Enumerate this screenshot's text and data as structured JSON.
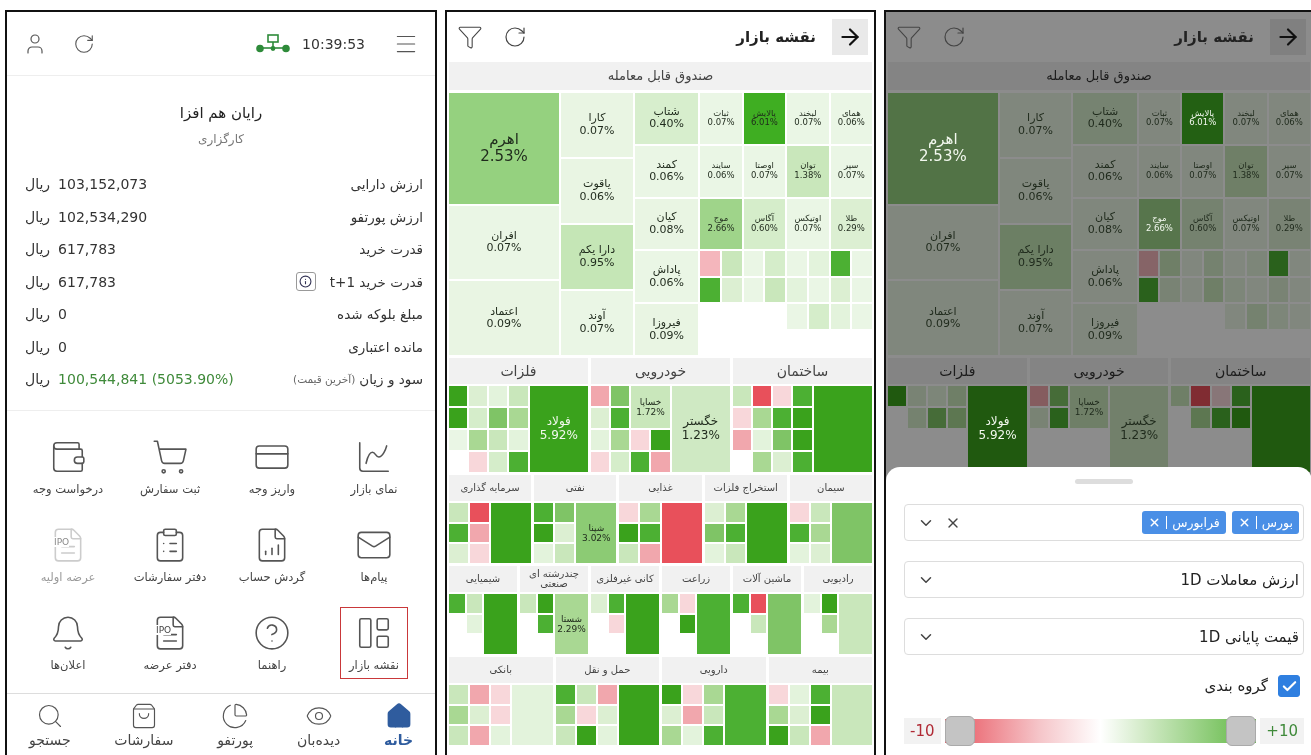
{
  "home": {
    "clock": "10:39:53",
    "broker": {
      "name": "رایان هم افزا",
      "type": "کارگزاری"
    },
    "rows": [
      {
        "label": "ارزش دارایی",
        "value": "103,152,073",
        "unit": "ریال"
      },
      {
        "label": "ارزش پورتفو",
        "value": "102,534,290",
        "unit": "ریال"
      },
      {
        "label": "قدرت خرید",
        "value": "617,783",
        "unit": "ریال"
      },
      {
        "label": "قدرت خرید t+1",
        "info": true,
        "value": "617,783",
        "unit": "ریال"
      },
      {
        "label": "مبلغ بلوکه شده",
        "value": "0",
        "unit": "ریال"
      },
      {
        "label": "مانده اعتباری",
        "value": "0",
        "unit": "ریال"
      },
      {
        "label": "سود و زیان",
        "note": "(آخرین قیمت)",
        "value": "100,544,841 (5053.90%)",
        "unit": "ریال",
        "positive": true
      }
    ],
    "shortcuts": [
      {
        "label": "نمای بازار",
        "disabled": false,
        "highlighted": false
      },
      {
        "label": "واریز وجه",
        "disabled": false,
        "highlighted": false
      },
      {
        "label": "ثبت سفارش",
        "disabled": false,
        "highlighted": false
      },
      {
        "label": "درخواست وجه",
        "disabled": false,
        "highlighted": false
      },
      {
        "label": "پیام‌ها",
        "disabled": false,
        "highlighted": false
      },
      {
        "label": "گردش حساب",
        "disabled": false,
        "highlighted": false
      },
      {
        "label": "دفتر سفارشات",
        "disabled": false,
        "highlighted": false
      },
      {
        "label": "عرضه اولیه",
        "icon_text": "IPO",
        "disabled": true,
        "highlighted": false
      },
      {
        "label": "نقشه بازار",
        "disabled": false,
        "highlighted": true
      },
      {
        "label": "راهنما",
        "disabled": false,
        "highlighted": false
      },
      {
        "label": "دفتر عرضه",
        "icon_text": "IPO",
        "disabled": false,
        "highlighted": false
      },
      {
        "label": "اعلان‌ها",
        "disabled": false,
        "highlighted": false
      }
    ],
    "nav": [
      {
        "label": "خانه",
        "selected": true
      },
      {
        "label": "دیده‌بان",
        "selected": false
      },
      {
        "label": "پورتفو",
        "selected": false
      },
      {
        "label": "سفارشات",
        "selected": false
      },
      {
        "label": "جستجو",
        "selected": false
      }
    ]
  },
  "market_map": {
    "title": "نقشه بازار",
    "fund": {
      "title": "صندوق قابل معامله",
      "cluster": [
        {
          "label": "همای",
          "value": "0.06%",
          "color": "#eaf6e5"
        },
        {
          "label": "لبخند",
          "value": "0.07%",
          "color": "#eaf6e5"
        },
        {
          "label": "پالایش",
          "value": "6.01%",
          "color": "#3fae22"
        },
        {
          "label": "ثبات",
          "value": "0.07%",
          "color": "#eaf6e5"
        },
        {
          "label": "سپر",
          "value": "0.07%",
          "color": "#eaf6e5"
        },
        {
          "label": "توان",
          "value": "1.38%",
          "color": "#c9e7bb"
        },
        {
          "label": "اوصتا",
          "value": "0.07%",
          "color": "#eaf6e5"
        },
        {
          "label": "سایند",
          "value": "0.06%",
          "color": "#eaf6e5"
        },
        {
          "label": "طلا",
          "value": "0.29%",
          "color": "#dcefd2"
        },
        {
          "label": "اوتیکس",
          "value": "0.07%",
          "color": "#eaf6e5"
        },
        {
          "label": "آگاس",
          "value": "0.60%",
          "color": "#d5edca"
        },
        {
          "label": "موج",
          "value": "2.66%",
          "color": "#9fd48a"
        },
        {
          "color": "#eaf6e5"
        },
        {
          "color": "#4cb033"
        },
        {
          "color": "#e3f3dc"
        },
        {
          "color": "#eaf6e5"
        },
        {
          "color": "#d5edca"
        },
        {
          "color": "#eaf6e5"
        },
        {
          "color": "#c9e7bb"
        },
        {
          "color": "#f4b6bc"
        },
        {
          "color": "#eaf6e5"
        },
        {
          "color": "#dcefd2"
        },
        {
          "color": "#eaf6e5"
        },
        {
          "color": "#e3f3dc"
        },
        {
          "color": "#c9e7bb"
        },
        {
          "color": "#eaf6e5"
        },
        {
          "color": "#dcefd2"
        },
        {
          "color": "#4cb033"
        },
        {
          "color": "#eaf6e5"
        },
        {
          "color": "#e3f3dc"
        },
        {
          "color": "#d5edca"
        },
        {
          "color": "#eaf6e5"
        }
      ],
      "columns": [
        [
          {
            "label": "شتاب",
            "value": "0.40%",
            "color": "#d7eecd"
          },
          {
            "label": "کمند",
            "value": "0.06%",
            "color": "#eaf6e5"
          },
          {
            "label": "کیان",
            "value": "0.08%",
            "color": "#e9f5e3"
          },
          {
            "label": "پاداش",
            "value": "0.06%",
            "color": "#eaf6e5"
          },
          {
            "label": "فیروزا",
            "value": "0.09%",
            "color": "#e9f5e3"
          }
        ],
        [
          {
            "label": "کارا",
            "value": "0.07%",
            "color": "#e9f5e3"
          },
          {
            "label": "یاقوت",
            "value": "0.06%",
            "color": "#e9f5e3"
          },
          {
            "label": "دارا یکم",
            "value": "0.95%",
            "color": "#c5e6b6"
          },
          {
            "label": "آوند",
            "value": "0.07%",
            "color": "#eaf6e5"
          }
        ],
        [
          {
            "label": "اهرم",
            "value": "2.53%",
            "color": "#95d17f"
          },
          {
            "label": "افران",
            "value": "0.07%",
            "color": "#eaf6e5"
          },
          {
            "label": "اعتماد",
            "value": "0.09%",
            "color": "#e9f5e3"
          }
        ]
      ]
    },
    "sector_rows": [
      [
        {
          "title": "ساختمان",
          "tiles": [
            {
              "color": "#3aa21c"
            },
            {
              "color": "#4cb033"
            },
            {
              "color": "#f8d7da"
            },
            {
              "color": "#e8505b"
            },
            {
              "color": "#c9e7bb"
            },
            {
              "color": "#3aa21c"
            },
            {
              "color": "#4cb033"
            },
            {
              "color": "#a9d893"
            },
            {
              "color": "#f8d7da"
            },
            {
              "color": "#3aa21c"
            },
            {
              "color": "#7fc466"
            },
            {
              "color": "#e3f3dc"
            },
            {
              "color": "#f1a7ad"
            },
            {
              "color": "#4cb033"
            },
            {
              "color": "#dcefd2"
            },
            {
              "color": "#a9d893"
            }
          ]
        },
        {
          "title": "خودرویی",
          "tiles": [
            {
              "label": "خگستر",
              "value": "1.23%",
              "color": "#cfe9c3"
            },
            {
              "label": "خساپا",
              "value": "1.72%",
              "color": "#c9e7bb"
            },
            {
              "color": "#7fc466"
            },
            {
              "color": "#f1a7ad"
            },
            {
              "color": "#4cb033"
            },
            {
              "color": "#dcefd2"
            },
            {
              "color": "#3aa21c"
            },
            {
              "color": "#f8d7da"
            },
            {
              "color": "#a9d893"
            },
            {
              "color": "#e3f3dc"
            },
            {
              "color": "#f1a7ad"
            },
            {
              "color": "#4cb033"
            },
            {
              "color": "#d5edca"
            },
            {
              "color": "#f8d7da"
            }
          ]
        },
        {
          "title": "فلزات",
          "tiles": [
            {
              "label": "فولاد",
              "value": "5.92%",
              "color": "#3aa21c"
            },
            {
              "color": "#c9e7bb"
            },
            {
              "color": "#e3f3dc"
            },
            {
              "color": "#dcefd2"
            },
            {
              "color": "#3aa21c"
            },
            {
              "color": "#a9d893"
            },
            {
              "color": "#7fc466"
            },
            {
              "color": "#d5edca"
            },
            {
              "color": "#3aa21c"
            },
            {
              "color": "#e3f3dc"
            },
            {
              "color": "#c9e7bb"
            },
            {
              "color": "#a9d893"
            },
            {
              "color": "#eaf6e5"
            },
            {
              "color": "#4cb033"
            },
            {
              "color": "#d5edca"
            },
            {
              "color": "#f8d7da"
            }
          ]
        }
      ],
      [
        {
          "title": "سیمان",
          "tiles": [
            {
              "color": "#7fc466"
            },
            {
              "color": "#c9e7bb"
            },
            {
              "color": "#f8d7da"
            },
            {
              "color": "#a9d893"
            },
            {
              "color": "#4cb033"
            },
            {
              "color": "#dcefd2"
            },
            {
              "color": "#e3f3dc"
            }
          ]
        },
        {
          "title": "استخراج فلزات",
          "tiles": [
            {
              "color": "#3aa21c"
            },
            {
              "color": "#a9d893"
            },
            {
              "color": "#dcefd2"
            },
            {
              "color": "#4cb033"
            },
            {
              "color": "#7fc466"
            },
            {
              "color": "#c9e7bb"
            },
            {
              "color": "#e3f3dc"
            }
          ]
        },
        {
          "title": "غذایی",
          "tiles": [
            {
              "color": "#e8505b"
            },
            {
              "color": "#a9d893"
            },
            {
              "color": "#f8d7da"
            },
            {
              "color": "#4cb033"
            },
            {
              "color": "#3aa21c"
            },
            {
              "color": "#f1a7ad"
            },
            {
              "color": "#c9e7bb"
            }
          ]
        },
        {
          "title": "نفتی",
          "tiles": [
            {
              "label": "شپنا",
              "value": "3.02%",
              "color": "#8ccb74"
            },
            {
              "color": "#7fc466"
            },
            {
              "color": "#4cb033"
            },
            {
              "color": "#dcefd2"
            },
            {
              "color": "#3aa21c"
            },
            {
              "color": "#c9e7bb"
            },
            {
              "color": "#e3f3dc"
            }
          ]
        },
        {
          "title": "سرمایه گذاری",
          "tiles": [
            {
              "color": "#3aa21c"
            },
            {
              "color": "#e8505b"
            },
            {
              "color": "#c9e7bb"
            },
            {
              "color": "#f1a7ad"
            },
            {
              "color": "#4cb033"
            },
            {
              "color": "#f8d7da"
            },
            {
              "color": "#dcefd2"
            }
          ]
        }
      ],
      [
        {
          "title": "رادیویی",
          "tiles": [
            {
              "color": "#c9e7bb"
            },
            {
              "color": "#3aa21c"
            },
            {
              "color": "#e3f3dc"
            },
            {
              "color": "#a9d893"
            }
          ]
        },
        {
          "title": "ماشین آلات",
          "tiles": [
            {
              "color": "#7fc466"
            },
            {
              "color": "#e8505b"
            },
            {
              "color": "#4cb033"
            },
            {
              "color": "#c9e7bb"
            }
          ]
        },
        {
          "title": "زراعت",
          "tiles": [
            {
              "color": "#4cb033"
            },
            {
              "color": "#f8d7da"
            },
            {
              "color": "#a9d893"
            },
            {
              "color": "#3aa21c"
            }
          ]
        },
        {
          "title": "کانی غیرفلزی",
          "tiles": [
            {
              "color": "#3aa21c"
            },
            {
              "color": "#4cb033"
            },
            {
              "color": "#dcefd2"
            },
            {
              "color": "#f8d7da"
            }
          ]
        },
        {
          "title": "چندرشته ای صنعتی",
          "tiles": [
            {
              "label": "شستا",
              "value": "2.29%",
              "color": "#a9d893"
            },
            {
              "color": "#3aa21c"
            },
            {
              "color": "#c9e7bb"
            },
            {
              "color": "#4cb033"
            }
          ]
        },
        {
          "title": "شیمیایی",
          "tiles": [
            {
              "color": "#3aa21c"
            },
            {
              "color": "#c9e7bb"
            },
            {
              "color": "#4cb033"
            },
            {
              "color": "#e3f3dc"
            }
          ]
        }
      ],
      [
        {
          "title": "بیمه",
          "tiles": [
            {
              "color": "#c9e7bb"
            },
            {
              "color": "#4cb033"
            },
            {
              "color": "#e3f3dc"
            },
            {
              "color": "#f8d7da"
            },
            {
              "color": "#3aa21c"
            },
            {
              "color": "#dcefd2"
            },
            {
              "color": "#a9d893"
            },
            {
              "color": "#f1a7ad"
            },
            {
              "color": "#c9e7bb"
            },
            {
              "color": "#3aa21c"
            }
          ]
        },
        {
          "title": "دارویی",
          "tiles": [
            {
              "color": "#4cb033"
            },
            {
              "color": "#a9d893"
            },
            {
              "color": "#f8d7da"
            },
            {
              "color": "#3aa21c"
            },
            {
              "color": "#c9e7bb"
            },
            {
              "color": "#f1a7ad"
            },
            {
              "color": "#dcefd2"
            },
            {
              "color": "#4cb033"
            },
            {
              "color": "#e3f3dc"
            },
            {
              "color": "#a9d893"
            }
          ]
        },
        {
          "title": "حمل و نقل",
          "tiles": [
            {
              "color": "#3aa21c"
            },
            {
              "color": "#f1a7ad"
            },
            {
              "color": "#c9e7bb"
            },
            {
              "color": "#4cb033"
            },
            {
              "color": "#dcefd2"
            },
            {
              "color": "#f8d7da"
            },
            {
              "color": "#a9d893"
            },
            {
              "color": "#e3f3dc"
            },
            {
              "color": "#3aa21c"
            },
            {
              "color": "#c9e7bb"
            }
          ]
        },
        {
          "title": "بانکی",
          "tiles": [
            {
              "color": "#e3f3dc"
            },
            {
              "color": "#f8d7da"
            },
            {
              "color": "#f1a7ad"
            },
            {
              "color": "#c9e7bb"
            },
            {
              "color": "#f8d7da"
            },
            {
              "color": "#dcefd2"
            },
            {
              "color": "#a9d893"
            },
            {
              "color": "#e3f3dc"
            },
            {
              "color": "#f1a7ad"
            },
            {
              "color": "#c9e7bb"
            }
          ]
        }
      ]
    ]
  },
  "market_map_filter": {
    "title": "نقشه بازار",
    "fund": {
      "title": "صندوق قابل معامله",
      "cluster": [
        {
          "label": "همای",
          "value": "0.06%",
          "color": "#81877e"
        },
        {
          "label": "لبخند",
          "value": "0.07%",
          "color": "#81877e"
        },
        {
          "label": "پالایش",
          "value": "6.01%",
          "color": "#236013"
        },
        {
          "label": "ثبات",
          "value": "0.07%",
          "color": "#81877e"
        },
        {
          "label": "سپر",
          "value": "0.07%",
          "color": "#81877e"
        },
        {
          "label": "توان",
          "value": "1.38%",
          "color": "#6f7f67"
        },
        {
          "label": "اوصتا",
          "value": "0.07%",
          "color": "#81877e"
        },
        {
          "label": "سایند",
          "value": "0.06%",
          "color": "#81877e"
        },
        {
          "label": "طلا",
          "value": "0.29%",
          "color": "#798374"
        },
        {
          "label": "اوتیکس",
          "value": "0.07%",
          "color": "#81877e"
        },
        {
          "label": "آگاس",
          "value": "0.60%",
          "color": "#75826f"
        },
        {
          "label": "موج",
          "value": "2.66%",
          "color": "#57754c"
        },
        {
          "color": "#81877e"
        },
        {
          "color": "#2a611c"
        },
        {
          "color": "#7d8679"
        },
        {
          "color": "#81877e"
        },
        {
          "color": "#75826f"
        },
        {
          "color": "#81877e"
        },
        {
          "color": "#6f7f67"
        },
        {
          "color": "#866467"
        },
        {
          "color": "#81877e"
        },
        {
          "color": "#798374"
        },
        {
          "color": "#81877e"
        },
        {
          "color": "#7d8679"
        },
        {
          "color": "#6f7f67"
        },
        {
          "color": "#81877e"
        },
        {
          "color": "#798374"
        },
        {
          "color": "#2a611c"
        },
        {
          "color": "#81877e"
        },
        {
          "color": "#7d8679"
        },
        {
          "color": "#75826f"
        },
        {
          "color": "#81877e"
        }
      ],
      "columns": [
        [
          {
            "label": "شتاب",
            "value": "0.40%",
            "color": "#768371"
          },
          {
            "label": "کمند",
            "value": "0.06%",
            "color": "#81877e"
          },
          {
            "label": "کیان",
            "value": "0.08%",
            "color": "#80877d"
          },
          {
            "label": "پاداش",
            "value": "0.06%",
            "color": "#81877e"
          },
          {
            "label": "فیروزا",
            "value": "0.09%",
            "color": "#80877d"
          }
        ],
        [
          {
            "label": "کارا",
            "value": "0.07%",
            "color": "#80877d"
          },
          {
            "label": "یاقوت",
            "value": "0.06%",
            "color": "#80877d"
          },
          {
            "label": "دارا یکم",
            "value": "0.95%",
            "color": "#6c7f64"
          },
          {
            "label": "آوند",
            "value": "0.07%",
            "color": "#81877e"
          }
        ],
        [
          {
            "label": "اهرم",
            "value": "2.53%",
            "color": "#527346"
          },
          {
            "label": "افران",
            "value": "0.07%",
            "color": "#81877e"
          },
          {
            "label": "اعتماد",
            "value": "0.09%",
            "color": "#80877d"
          }
        ]
      ]
    },
    "sector_rows": [
      [
        {
          "title": "ساختمان",
          "tiles": [
            {
              "color": "#20590f"
            },
            {
              "color": "#2a611c"
            },
            {
              "color": "#887678"
            },
            {
              "color": "#802c32"
            },
            {
              "color": "#6f7f67"
            },
            {
              "color": "#20590f"
            },
            {
              "color": "#2a611c"
            },
            {
              "color": "#5d7751"
            }
          ]
        },
        {
          "title": "خودرویی",
          "tiles": [
            {
              "label": "خگستر",
              "value": "1.23%",
              "color": "#72806b"
            },
            {
              "label": "خساپا",
              "value": "1.72%",
              "color": "#6f7f67"
            },
            {
              "color": "#466c38"
            },
            {
              "color": "#855c5f"
            },
            {
              "color": "#2a611c"
            },
            {
              "color": "#798374"
            }
          ]
        },
        {
          "title": "فلزات",
          "tiles": [
            {
              "label": "فولاد",
              "value": "5.92%",
              "color": "#20590f"
            },
            {
              "color": "#6f7f67"
            },
            {
              "color": "#7d8679"
            },
            {
              "color": "#798374"
            },
            {
              "color": "#20590f"
            },
            {
              "color": "#5d7751"
            },
            {
              "color": "#466c38"
            },
            {
              "color": "#75826f"
            }
          ]
        }
      ]
    ],
    "sheet": {
      "markets": [
        {
          "label": "بورس"
        },
        {
          "label": "فرابورس"
        }
      ],
      "size_by": "ارزش معاملات 1D",
      "color_by": "قیمت پایانی 1D",
      "grouping": {
        "label": "گروه بندی",
        "checked": true
      },
      "range": {
        "min": "-10",
        "max": "+10",
        "thumbs": [
          {
            "level": 0
          },
          {
            "level": 1
          }
        ]
      }
    }
  }
}
